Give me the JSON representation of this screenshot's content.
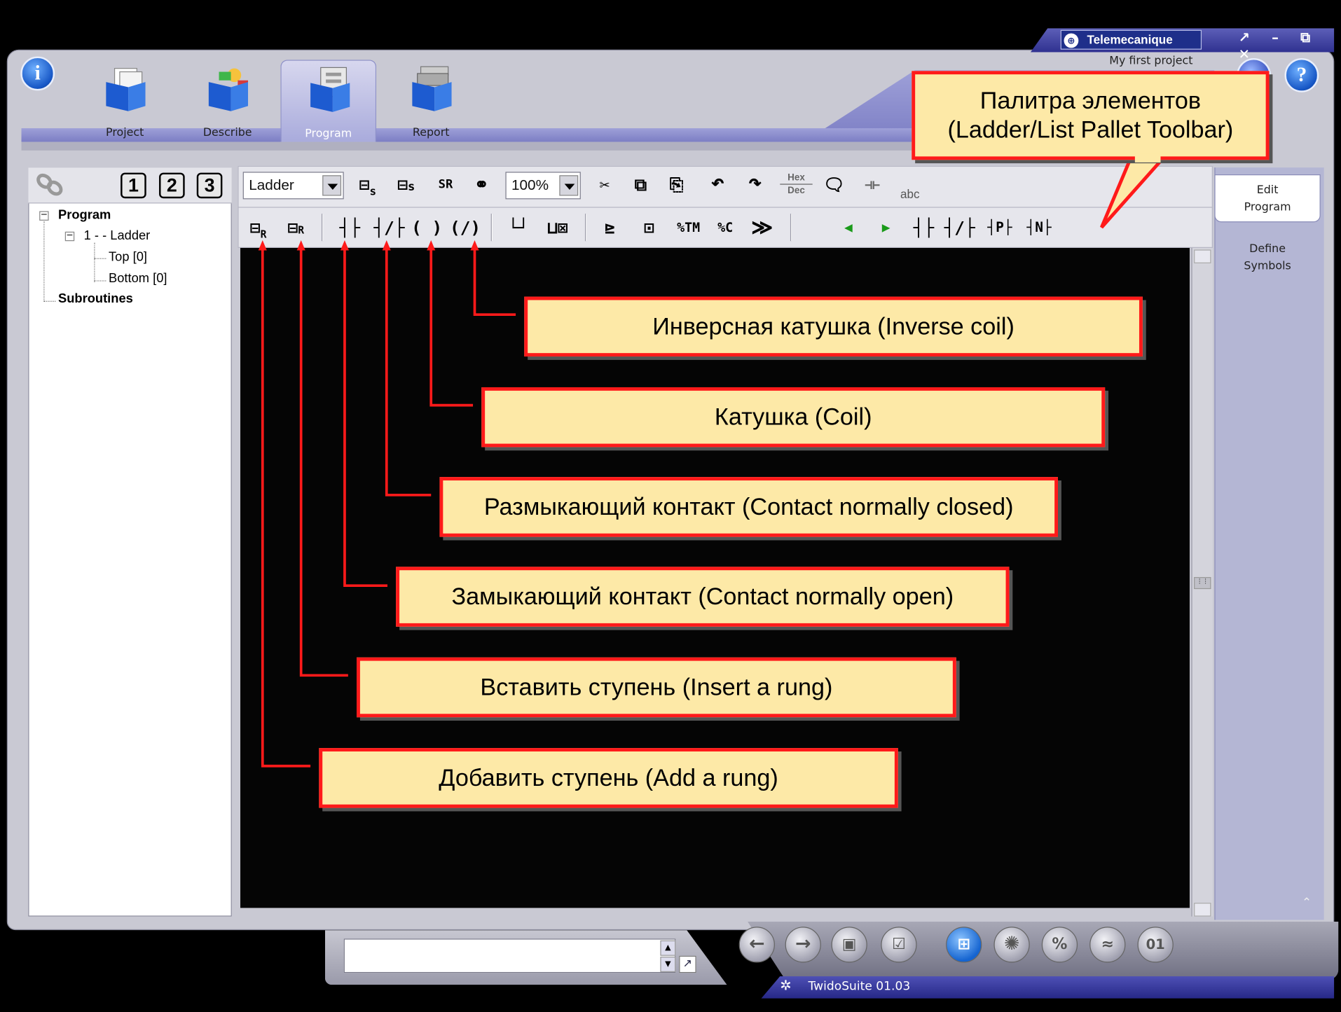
{
  "brand": {
    "name": "Telemecanique",
    "project": "My first project",
    "window_buttons": "↗ – ⧉ ✕"
  },
  "tabs": [
    {
      "label": "Project",
      "icon": "project-folder-icon"
    },
    {
      "label": "Describe",
      "icon": "describe-folder-icon"
    },
    {
      "label": "Program",
      "icon": "program-folder-icon",
      "selected": true
    },
    {
      "label": "Report",
      "icon": "report-folder-icon"
    }
  ],
  "info_glyph": "i",
  "help_glyph": "?",
  "left_tools": {
    "numbers": [
      "1",
      "2",
      "3"
    ]
  },
  "tree": {
    "program": "Program",
    "ladder": "1 -  - Ladder",
    "top": "Top [0]",
    "bottom": "Bottom [0]",
    "subroutines": "Subroutines"
  },
  "toolbar": {
    "mode": "Ladder",
    "zoom": "100%",
    "hex": "Hex",
    "dec": "Dec",
    "tm": "%TM",
    "c": "%C",
    "abc": "abc"
  },
  "right_pane": {
    "edit": [
      "Edit",
      "Program"
    ],
    "define": [
      "Define",
      "Symbols"
    ]
  },
  "footer": {
    "version": "TwidoSuite 01.03"
  },
  "callouts": {
    "pallet": [
      "Палитра элементов",
      "(Ladder/List Pallet Toolbar)"
    ],
    "inverse_coil": "Инверсная катушка (Inverse coil)",
    "coil": "Катушка (Coil)",
    "nc_contact": "Размыкающий контакт (Contact normally closed)",
    "no_contact": "Замыкающий контакт (Contact normally open)",
    "insert_rung": "Вставить ступень (Insert a rung)",
    "add_rung": "Добавить ступень (Add a rung)"
  },
  "colors": {
    "callout_fill": "#fde9a7",
    "callout_border": "#ff1a1a",
    "accent": "#7c7ec4",
    "canvas": "#050505"
  }
}
